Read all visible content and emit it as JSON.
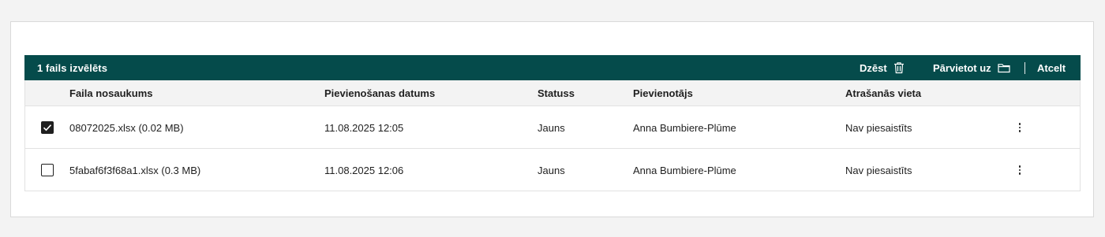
{
  "selection_bar": {
    "count_label": "1 fails izvēlēts",
    "delete_label": "Dzēst",
    "move_label": "Pārvietot uz",
    "cancel_label": "Atcelt",
    "background_color": "#054b4b"
  },
  "table": {
    "columns": [
      "Faila nosaukums",
      "Pievienošanas datums",
      "Statuss",
      "Pievienotājs",
      "Atrašanās vieta"
    ],
    "rows": [
      {
        "selected": true,
        "name": "08072025.xlsx (0.02 MB)",
        "date": "11.08.2025 12:05",
        "status": "Jauns",
        "uploader": "Anna Bumbiere-Plūme",
        "location": "Nav piesaistīts"
      },
      {
        "selected": false,
        "name": "5fabaf6f3f68a1.xlsx (0.3 MB)",
        "date": "11.08.2025 12:06",
        "status": "Jauns",
        "uploader": "Anna Bumbiere-Plūme",
        "location": "Nav piesaistīts"
      }
    ]
  },
  "icons": {
    "delete": "trash-icon",
    "move": "folder-icon",
    "row_menu": "more-vertical-icon",
    "checkbox": "checkmark-icon"
  }
}
